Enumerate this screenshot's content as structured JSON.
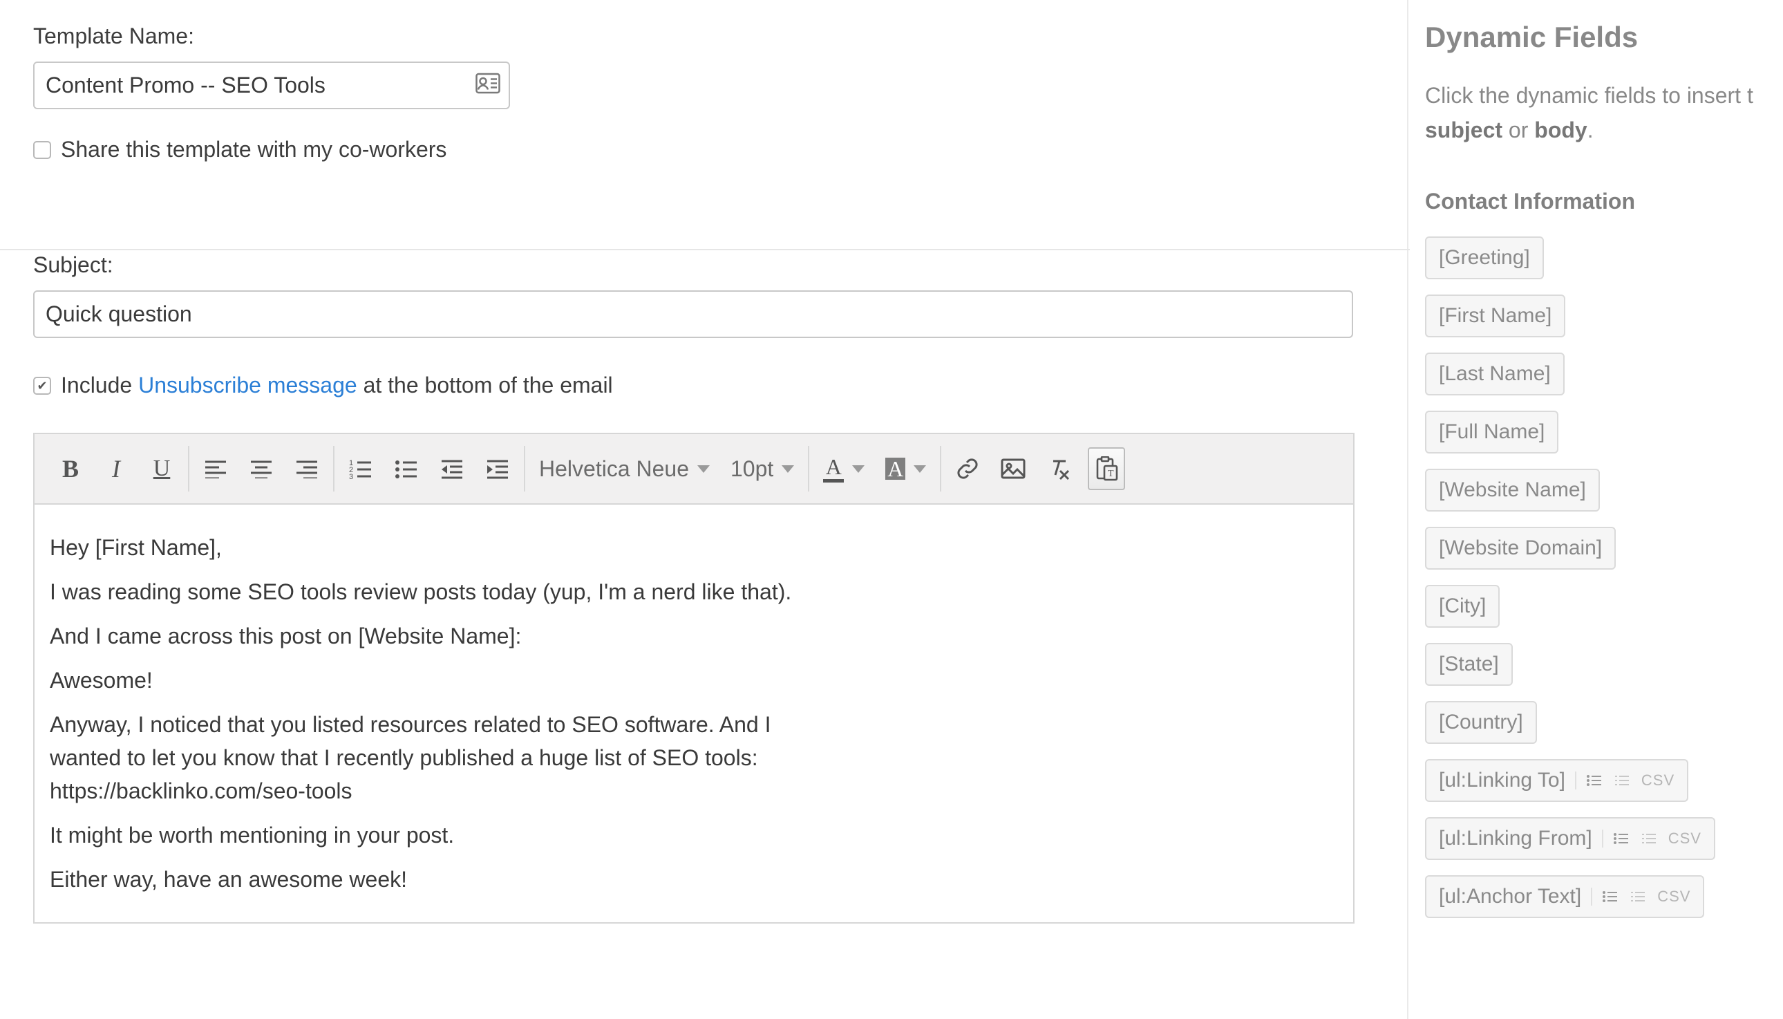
{
  "templateName": {
    "label": "Template Name:",
    "value": "Content Promo -- SEO Tools"
  },
  "shareCheckbox": {
    "label": "Share this template with my co-workers",
    "checked": false
  },
  "subject": {
    "label": "Subject:",
    "value": "Quick question"
  },
  "unsubscribe": {
    "checked": true,
    "prefix": "Include ",
    "link": "Unsubscribe message",
    "suffix": " at the bottom of the email"
  },
  "toolbar": {
    "fontFamily": "Helvetica Neue",
    "fontSize": "10pt"
  },
  "body": {
    "p1": "Hey [First Name],",
    "p2": "I was reading some SEO tools review posts today (yup, I'm a nerd like that).",
    "p3": "And I came across this post on [Website Name]:",
    "p4": "Awesome!",
    "p5a": "Anyway, I noticed that you listed resources related to SEO software. And I",
    "p5b": "wanted to let you know that I recently published a huge list of SEO tools:",
    "p5c": "https://backlinko.com/seo-tools",
    "p6": "It might be worth mentioning in your post.",
    "p7": "Either way, have an awesome week!"
  },
  "sidebar": {
    "title": "Dynamic Fields",
    "desc_prefix": "Click the dynamic fields to insert t",
    "desc_bold1": "subject",
    "desc_or": " or ",
    "desc_bold2": "body",
    "desc_suffix": ".",
    "sectionTitle": "Contact Information",
    "fields": [
      {
        "label": "[Greeting]",
        "extras": false
      },
      {
        "label": "[First Name]",
        "extras": false
      },
      {
        "label": "[Last Name]",
        "extras": false
      },
      {
        "label": "[Full Name]",
        "extras": false
      },
      {
        "label": "[Website Name]",
        "extras": false
      },
      {
        "label": "[Website Domain]",
        "extras": false
      },
      {
        "label": "[City]",
        "extras": false
      },
      {
        "label": "[State]",
        "extras": false
      },
      {
        "label": "[Country]",
        "extras": false
      },
      {
        "label": "[ul:Linking To]",
        "extras": true,
        "csv": "CSV"
      },
      {
        "label": "[ul:Linking From]",
        "extras": true,
        "csv": "CSV"
      },
      {
        "label": "[ul:Anchor Text]",
        "extras": true,
        "csv": "CSV"
      }
    ]
  }
}
